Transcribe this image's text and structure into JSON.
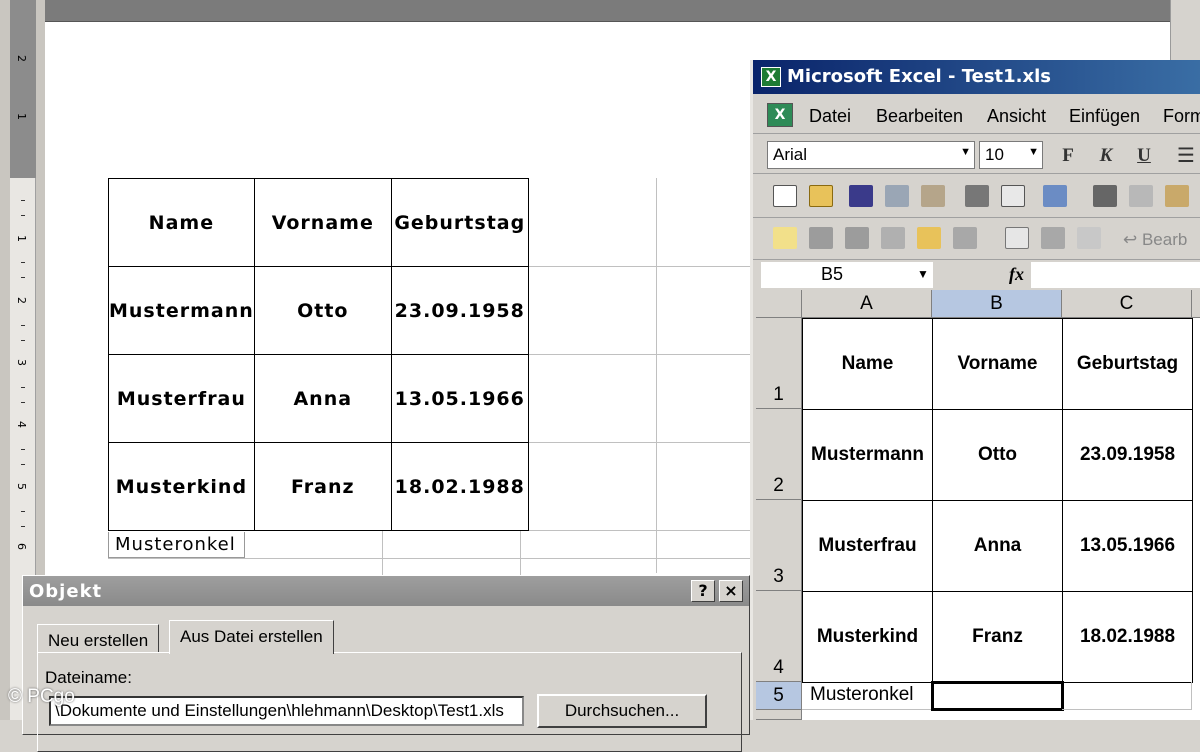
{
  "word": {
    "ruler_numbers": [
      "2",
      "1",
      "1",
      "2",
      "3",
      "4",
      "5",
      "6"
    ],
    "table": [
      [
        "Name",
        "Vorname",
        "Geburtstag"
      ],
      [
        "Mustermann",
        "Otto",
        "23.09.1958"
      ],
      [
        "Musterfrau",
        "Anna",
        "13.05.1966"
      ],
      [
        "Musterkind",
        "Franz",
        "18.02.1988"
      ]
    ],
    "extra_row": "Musteronkel"
  },
  "dialog": {
    "title": "Objekt",
    "help_button": "?",
    "close_button": "×",
    "tabs": [
      "Neu erstellen",
      "Aus Datei erstellen"
    ],
    "active_tab": "Aus Datei erstellen",
    "filename_label": "Dateiname:",
    "filename_value": "\\Dokumente und Einstellungen\\hlehmann\\Desktop\\Test1.xls",
    "browse_button": "Durchsuchen..."
  },
  "watermark": "© PCgo",
  "excel": {
    "title": "Microsoft Excel - Test1.xls",
    "menu": [
      "Datei",
      "Bearbeiten",
      "Ansicht",
      "Einfügen",
      "Form"
    ],
    "font_name": "Arial",
    "font_size": "10",
    "format_buttons": [
      "F",
      "K",
      "U"
    ],
    "toolbar_label": "Bearb",
    "name_box": "B5",
    "fx": "fx",
    "columns": [
      "A",
      "B",
      "C"
    ],
    "selected_column": "B",
    "rows": [
      "1",
      "2",
      "3",
      "4",
      "5"
    ],
    "selected_row": "5",
    "cells": [
      [
        "Name",
        "Vorname",
        "Geburtstag"
      ],
      [
        "Mustermann",
        "Otto",
        "23.09.1958"
      ],
      [
        "Musterfrau",
        "Anna",
        "13.05.1966"
      ],
      [
        "Musterkind",
        "Franz",
        "18.02.1988"
      ]
    ],
    "row5_a": "Musteronkel"
  },
  "colors": {
    "title_gradient_start": "#0a246a",
    "title_gradient_end": "#3a6ea5",
    "selection_header": "#b6c7e1"
  }
}
